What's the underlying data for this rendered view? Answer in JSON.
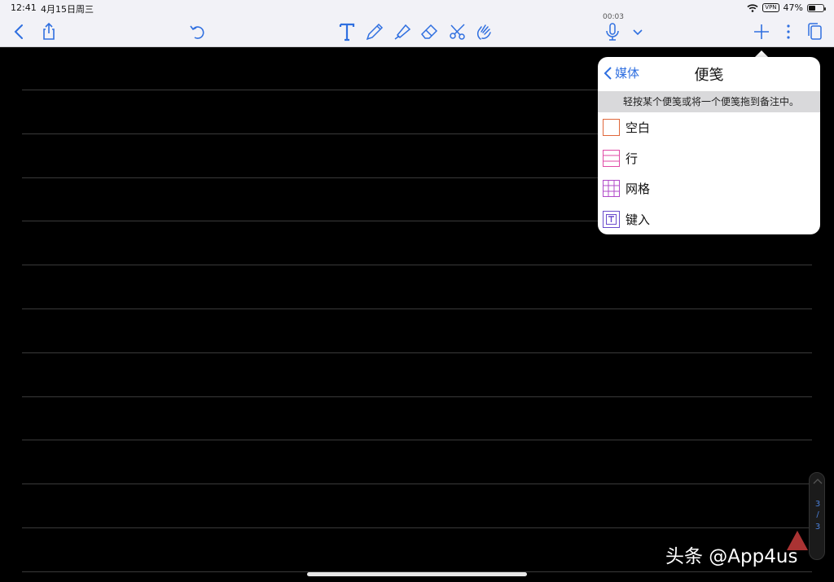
{
  "status_bar": {
    "time": "12:41",
    "date": "4月15日周三",
    "vpn": "VPN",
    "battery_percent": "47%",
    "battery_level": 0.47
  },
  "toolbar": {
    "recording_time": "00:03",
    "icons": [
      "back-icon",
      "share-icon",
      "undo-icon",
      "text-tool-icon",
      "pen-tool-icon",
      "highlighter-tool-icon",
      "eraser-tool-icon",
      "lasso-scissors-icon",
      "hand-tool-icon",
      "microphone-icon",
      "chevron-down-icon",
      "add-icon",
      "more-icon",
      "pages-icon"
    ],
    "accent_color": "#2f6fe0"
  },
  "popover": {
    "back_label": "媒体",
    "title": "便笺",
    "hint": "轻按某个便笺或将一个便笺拖到备注中。",
    "items": [
      {
        "label": "空白",
        "icon": "blank-paper-icon"
      },
      {
        "label": "行",
        "icon": "lined-paper-icon"
      },
      {
        "label": "网格",
        "icon": "grid-paper-icon"
      },
      {
        "label": "键入",
        "icon": "typed-paper-icon"
      }
    ]
  },
  "pager": {
    "current": "3",
    "separator": "/",
    "total": "3"
  },
  "watermark": "头条 @App4us"
}
